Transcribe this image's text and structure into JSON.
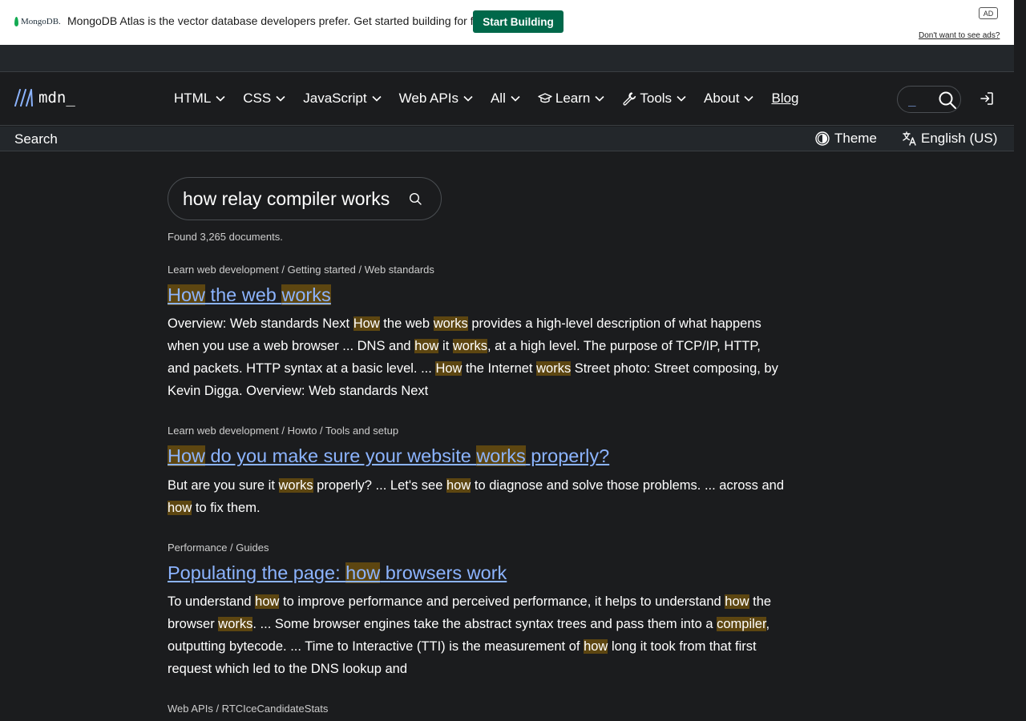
{
  "ad": {
    "logo": "MongoDB.",
    "text": "MongoDB Atlas is the vector database developers prefer. Get started building for free.",
    "button": "Start Building",
    "badge": "AD",
    "dismiss": "Don't want to see ads?"
  },
  "nav": {
    "logo_text": "mdn_",
    "items": [
      {
        "label": "HTML"
      },
      {
        "label": "CSS"
      },
      {
        "label": "JavaScript"
      },
      {
        "label": "Web APIs"
      },
      {
        "label": "All"
      },
      {
        "label": "Learn",
        "icon": "graduation-cap-icon"
      },
      {
        "label": "Tools",
        "icon": "wrench-icon"
      },
      {
        "label": "About"
      }
    ],
    "blog": "Blog",
    "search_cursor": "_"
  },
  "subbar": {
    "title": "Search",
    "theme": "Theme",
    "language": "English (US)"
  },
  "search": {
    "query": "how relay compiler works",
    "found": "Found 3,265 documents."
  },
  "results": [
    {
      "breadcrumb": "Learn web development / Getting started / Web standards",
      "title": [
        [
          "How",
          true
        ],
        [
          " the web ",
          false
        ],
        [
          "works",
          true
        ]
      ],
      "body": [
        [
          "Overview: Web standards Next ",
          false
        ],
        [
          "How",
          true
        ],
        [
          " the web ",
          false
        ],
        [
          "works",
          true
        ],
        [
          " provides a high-level description of what happens when you use a web browser ... DNS and ",
          false
        ],
        [
          "how",
          true
        ],
        [
          " it ",
          false
        ],
        [
          "works",
          true
        ],
        [
          ", at a high level. The purpose of TCP/IP, HTTP, and packets. HTTP syntax at a basic level. ... ",
          false
        ],
        [
          "How",
          true
        ],
        [
          " the Internet ",
          false
        ],
        [
          "works",
          true
        ],
        [
          " Street photo: Street composing, by Kevin Digga. Overview: Web standards Next",
          false
        ]
      ]
    },
    {
      "breadcrumb": "Learn web development / Howto / Tools and setup",
      "title": [
        [
          "How",
          true
        ],
        [
          " do you make sure your website ",
          false
        ],
        [
          "works",
          true
        ],
        [
          " properly?",
          false
        ]
      ],
      "body": [
        [
          "But are you sure it ",
          false
        ],
        [
          "works",
          true
        ],
        [
          " properly? ... Let's see ",
          false
        ],
        [
          "how",
          true
        ],
        [
          " to diagnose and solve those problems. ... across and ",
          false
        ],
        [
          "how",
          true
        ],
        [
          " to fix them.",
          false
        ]
      ]
    },
    {
      "breadcrumb": "Performance / Guides",
      "title": [
        [
          "Populating the page: ",
          false
        ],
        [
          "how",
          true
        ],
        [
          " browsers work",
          false
        ]
      ],
      "body": [
        [
          "To understand ",
          false
        ],
        [
          "how",
          true
        ],
        [
          " to improve performance and perceived performance, it helps to understand ",
          false
        ],
        [
          "how",
          true
        ],
        [
          " the browser ",
          false
        ],
        [
          "works",
          true
        ],
        [
          ". ... Some browser engines take the abstract syntax trees and pass them into a ",
          false
        ],
        [
          "compiler",
          true
        ],
        [
          ", outputting bytecode. ... Time to Interactive (TTI) is the measurement of ",
          false
        ],
        [
          "how",
          true
        ],
        [
          " long it took from that first request which led to the DNS lookup and",
          false
        ]
      ]
    },
    {
      "breadcrumb": "Web APIs / RTCIceCandidateStats",
      "title": [],
      "body": []
    }
  ],
  "colors": {
    "background": "#1b1c1e",
    "link": "#8cb4ff",
    "highlight": "#5d4611",
    "ad_button": "#00684a"
  }
}
